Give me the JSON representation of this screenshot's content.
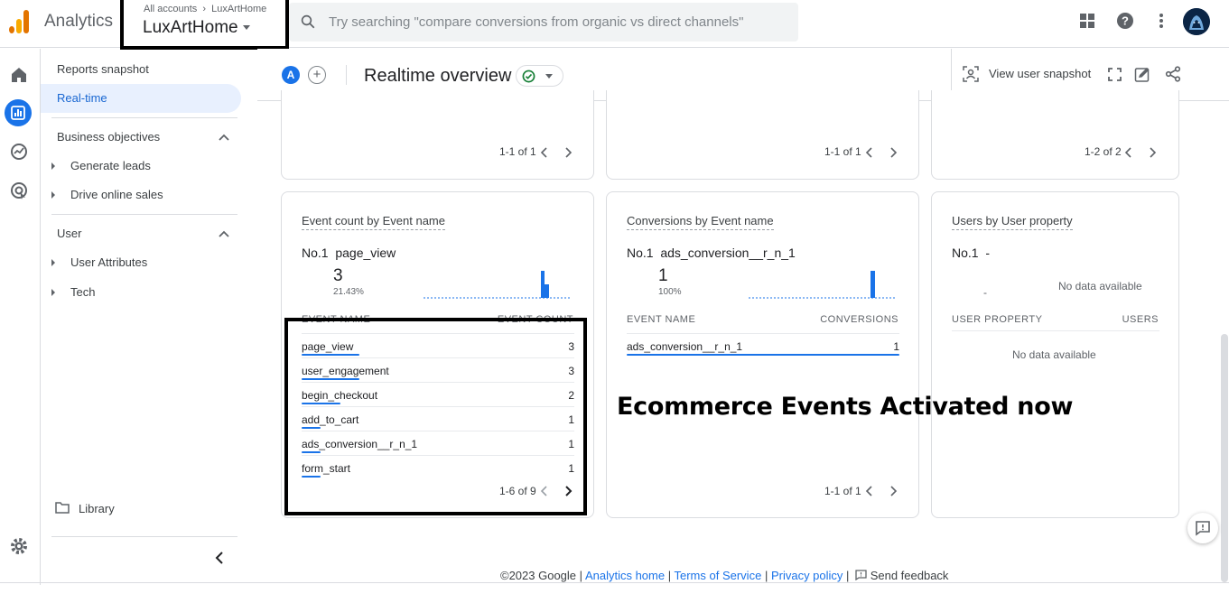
{
  "header": {
    "app_name": "Analytics",
    "account_crumb": "All accounts",
    "account_crumb_sub": "LuxArtHome",
    "property_name": "LuxArtHome",
    "search_placeholder": "Try searching \"compare conversions from organic vs direct channels\""
  },
  "nav": {
    "reports_snapshot": "Reports snapshot",
    "realtime": "Real-time",
    "business_objectives": "Business objectives",
    "generate_leads": "Generate leads",
    "drive_online_sales": "Drive online sales",
    "user": "User",
    "user_attributes": "User Attributes",
    "tech": "Tech",
    "library": "Library"
  },
  "subheader": {
    "segment_letter": "A",
    "title": "Realtime overview",
    "view_snapshot": "View user snapshot"
  },
  "top_cards": [
    {
      "pager": "1-1 of 1"
    },
    {
      "pager": "1-1 of 1"
    },
    {
      "pager": "1-2 of 2"
    }
  ],
  "events_card": {
    "title": "Event count by Event name",
    "rank": "No.1",
    "top_name": "page_view",
    "top_value": "3",
    "top_pct": "21.43%",
    "col_name": "EVENT NAME",
    "col_value": "EVENT COUNT",
    "rows": [
      {
        "name": "page_view",
        "value": "3",
        "share": 1.0
      },
      {
        "name": "user_engagement",
        "value": "3",
        "share": 1.0
      },
      {
        "name": "begin_checkout",
        "value": "2",
        "share": 0.67
      },
      {
        "name": "add_to_cart",
        "value": "1",
        "share": 0.33
      },
      {
        "name": "ads_conversion__r_n_1",
        "value": "1",
        "share": 0.33
      },
      {
        "name": "form_start",
        "value": "1",
        "share": 0.33
      }
    ],
    "pager": "1-6 of 9"
  },
  "conversions_card": {
    "title": "Conversions by Event name",
    "rank": "No.1",
    "top_name": "ads_conversion__r_n_1",
    "top_value": "1",
    "top_pct": "100%",
    "col_name": "EVENT NAME",
    "col_value": "CONVERSIONS",
    "rows": [
      {
        "name": "ads_conversion__r_n_1",
        "value": "1",
        "share": 1.0
      }
    ],
    "pager": "1-1 of 1"
  },
  "users_card": {
    "title": "Users by User property",
    "rank": "No.1",
    "top_name": "-",
    "dash": "-",
    "no_data_top": "No data available",
    "col_name": "USER PROPERTY",
    "col_value": "USERS",
    "no_data_table": "No data available"
  },
  "annotation": "Ecommerce Events Activated now",
  "footer": {
    "copyright": "©2023 Google |",
    "analytics_home": "Analytics home",
    "sep1": "|",
    "terms": "Terms of Service",
    "sep2": "|",
    "privacy": "Privacy policy",
    "sep3": "|",
    "send_feedback": "Send feedback"
  },
  "colors": {
    "accent": "#1a73e8",
    "logo_orange": "#f9ab00",
    "logo_dark": "#e37400",
    "success": "#188038"
  }
}
